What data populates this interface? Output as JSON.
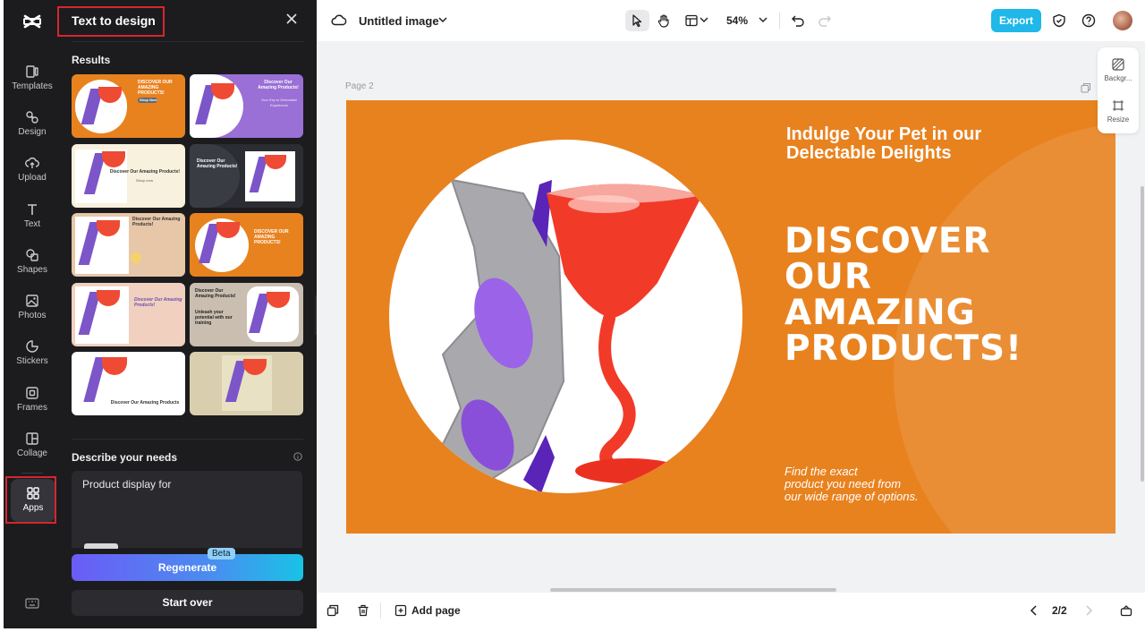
{
  "sidebar": {
    "items": [
      {
        "label": "Templates",
        "icon": "templates-icon"
      },
      {
        "label": "Design",
        "icon": "design-icon"
      },
      {
        "label": "Upload",
        "icon": "upload-icon"
      },
      {
        "label": "Text",
        "icon": "text-icon"
      },
      {
        "label": "Shapes",
        "icon": "shapes-icon"
      },
      {
        "label": "Photos",
        "icon": "photos-icon"
      },
      {
        "label": "Stickers",
        "icon": "stickers-icon"
      },
      {
        "label": "Frames",
        "icon": "frames-icon"
      },
      {
        "label": "Collage",
        "icon": "collage-icon"
      },
      {
        "label": "Apps",
        "icon": "apps-icon",
        "active": true
      }
    ]
  },
  "panel": {
    "title": "Text to design",
    "results_label": "Results",
    "thumbs": [
      {
        "text": "DISCOVER OUR AMAZING PRODUCTS!",
        "bg": "#e8821f",
        "button": "Shop Now"
      },
      {
        "text": "Discover Our Amazing Products!",
        "bg": "#9a6fd6",
        "sub": "Your Key to Delectable Experience"
      },
      {
        "text": "Discover Our Amazing Products!",
        "bg": "#f7f1dd",
        "button": "Shop now"
      },
      {
        "text": "Discover Our Amazing Products!",
        "bg": "#2b2d33"
      },
      {
        "text": "Discover Our Amazing Products!",
        "bg": "#e7c7a8"
      },
      {
        "text": "DISCOVER OUR AMAZING PRODUCTS!",
        "bg": "#e8821f"
      },
      {
        "text": "Discover Our Amazing Products!",
        "bg": "#f1d0c0"
      },
      {
        "text": "Discover Our Amazing Products!",
        "bg": "#c9beb0",
        "sub": "Unleash your potential with our training"
      },
      {
        "text": "Discover Our Amazing Products",
        "bg": "#ffffff"
      },
      {
        "text": "",
        "bg": "#d9cfae"
      }
    ],
    "needs_label": "Describe your needs",
    "needs_value": "Product display for",
    "regenerate": "Regenerate",
    "beta": "Beta",
    "start_over": "Start over"
  },
  "topbar": {
    "title": "Untitled image",
    "zoom": "54%",
    "export": "Export"
  },
  "canvas": {
    "page_label": "Page 2",
    "artboard": {
      "subtitle_line1": "Indulge Your Pet in our",
      "subtitle_line2": "Delectable Delights",
      "headline_line1": "DISCOVER",
      "headline_line2": "OUR",
      "headline_line3": "AMAZING",
      "headline_line4": "PRODUCTS!",
      "footer_line1": "Find the exact",
      "footer_line2": "product you need from",
      "footer_line3": "our wide range of options.",
      "bg_color": "#e8821f"
    },
    "side_tools": [
      {
        "label": "Backgr...",
        "icon": "background-icon"
      },
      {
        "label": "Resize",
        "icon": "resize-icon"
      }
    ]
  },
  "bottombar": {
    "add_page": "Add page",
    "pager": "2/2"
  },
  "colors": {
    "accent": "#1fb8e8",
    "highlight": "#d7262d",
    "dark_panel": "#1c1c1e"
  }
}
